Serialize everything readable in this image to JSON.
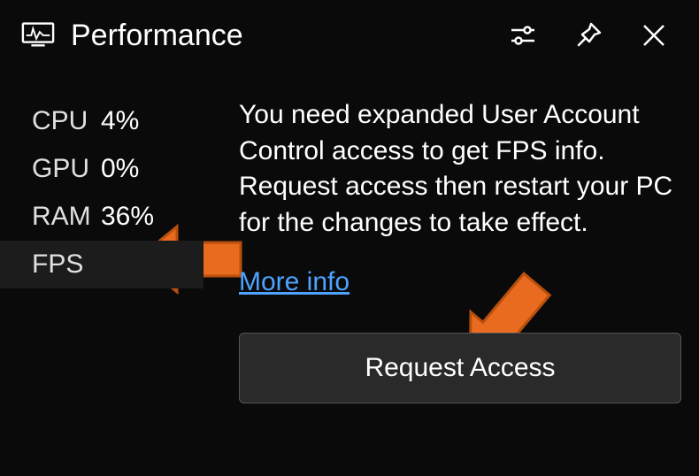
{
  "header": {
    "title": "Performance"
  },
  "stats": {
    "cpu": {
      "label": "CPU",
      "value": "4%"
    },
    "gpu": {
      "label": "GPU",
      "value": "0%"
    },
    "ram": {
      "label": "RAM",
      "value": "36%"
    },
    "fps": {
      "label": "FPS",
      "value": ""
    }
  },
  "message": {
    "text": "You need expanded User Account Control access to get FPS info. Request access then restart your PC for the changes to take effect.",
    "more_info": "More info",
    "request_button": "Request Access"
  }
}
